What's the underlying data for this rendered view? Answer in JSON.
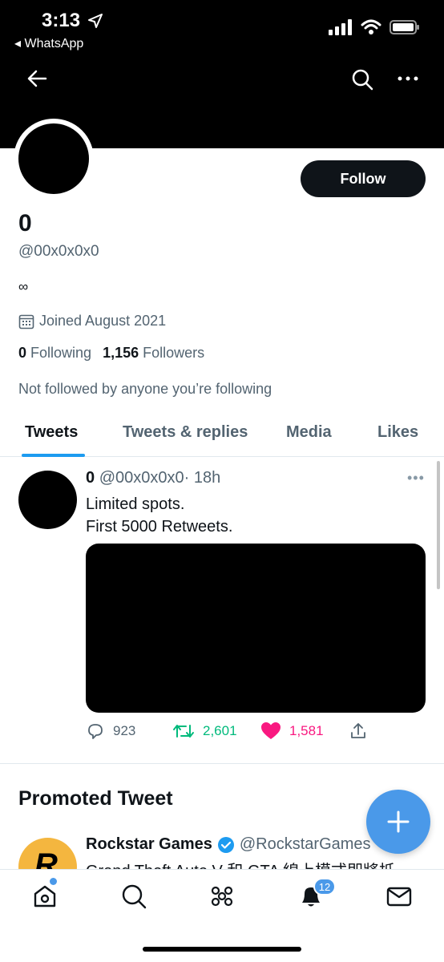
{
  "status_bar": {
    "time": "3:13",
    "back_app": "WhatsApp"
  },
  "profile": {
    "display_name": "0",
    "handle": "@00x0x0x0",
    "bio": "∞",
    "joined": "Joined August 2021",
    "following_count": "0",
    "following_label": "Following",
    "followers_count": "1,156",
    "followers_label": "Followers",
    "not_followed": "Not followed by anyone you’re following",
    "follow_label": "Follow"
  },
  "tabs": [
    {
      "label": "Tweets",
      "active": true
    },
    {
      "label": "Tweets & replies",
      "active": false
    },
    {
      "label": "Media",
      "active": false
    },
    {
      "label": "Likes",
      "active": false
    }
  ],
  "tweet": {
    "name": "0",
    "handle": "@00x0x0x0",
    "time": "· 18h",
    "line1": "Limited spots.",
    "line2": "First 5000 Retweets.",
    "replies": "923",
    "retweets": "2,601",
    "likes": "1,581"
  },
  "promoted": {
    "title": "Promoted Tweet",
    "name": "Rockstar Games",
    "handle": "@RockstarGames",
    "text": "Grand Theft Auto V 和 GTA 線上模式即將抵"
  },
  "nav": {
    "notifications_badge": "12"
  },
  "colors": {
    "accent": "#1d9bf0",
    "retweet": "#00ba7c",
    "like": "#f91880",
    "fab": "#4a99e9"
  },
  "icons": [
    "back-arrow-icon",
    "search-icon",
    "more-icon",
    "calendar-icon",
    "reply-icon",
    "retweet-icon",
    "heart-icon",
    "share-icon",
    "verified-icon",
    "plus-icon",
    "home-icon",
    "explore-icon",
    "spaces-icon",
    "bell-icon",
    "mail-icon"
  ]
}
